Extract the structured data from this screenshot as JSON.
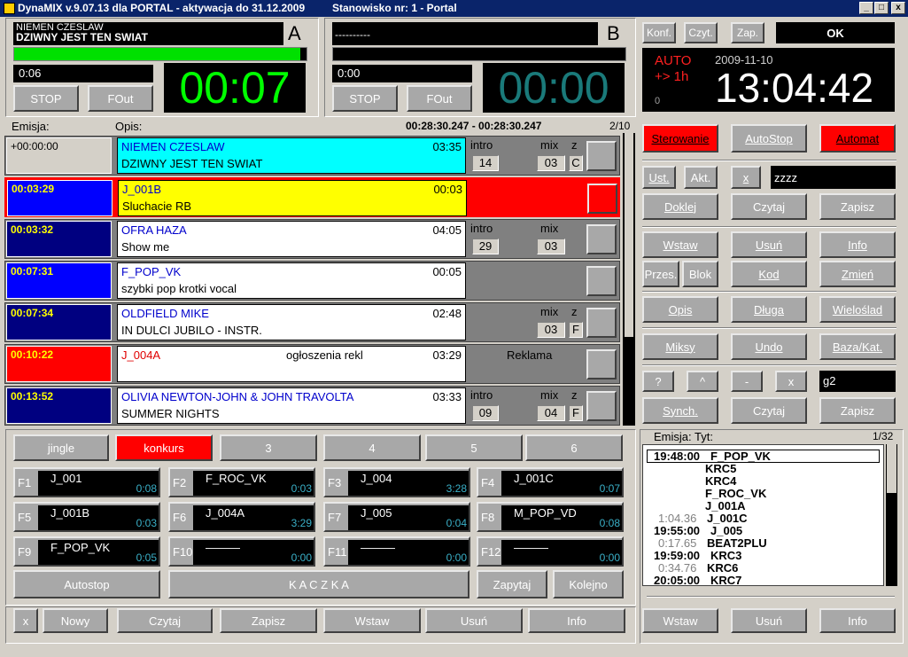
{
  "window": {
    "title": "DynaMIX v.9.07.13 dla PORTAL - aktywacja do 31.12.2009",
    "station": "Stanowisko nr: 1 - Portal",
    "min": "_",
    "max": "□",
    "close": "x"
  },
  "playerA": {
    "artist": "NIEMEN CZESLAW",
    "title": "DZIWNY JEST TEN SWIAT",
    "letter": "A",
    "elapsed": "0:06",
    "remaining": "00:07",
    "progress": 0.98,
    "stop": "STOP",
    "fout": "FOut"
  },
  "playerB": {
    "artist": "----------",
    "letter": "B",
    "elapsed": "0:00",
    "remaining": "00:00",
    "stop": "STOP",
    "fout": "FOut"
  },
  "top_right": {
    "konf": "Konf.",
    "czyt": "Czyt.",
    "zap": "Zap.",
    "ok": "OK",
    "auto": "AUTO",
    "offset": "+> 1h",
    "zero": "0",
    "date": "2009-11-10",
    "clock": "13:04:42"
  },
  "playlist": {
    "col_emisja": "Emisja:",
    "col_opis": "Opis:",
    "range": "00:28:30.247 - 00:28:30.247",
    "page": "2/10",
    "rows": [
      {
        "time": "+00:00:00",
        "artist": "NIEMEN CZESLAW",
        "title": "DZIWNY JEST TEN SWIAT",
        "dur": "03:35",
        "intro_lbl": "intro",
        "intro": "14",
        "mix_lbl": "mix",
        "mix": "03",
        "z_lbl": "z",
        "z": "C"
      },
      {
        "time": "00:03:29",
        "artist": "J_001B",
        "title": "Sluchacie RB",
        "dur": "00:03"
      },
      {
        "time": "00:03:32",
        "artist": "OFRA HAZA",
        "title": "Show me",
        "dur": "04:05",
        "intro_lbl": "intro",
        "intro": "29",
        "mix_lbl": "mix",
        "mix": "03"
      },
      {
        "time": "00:07:31",
        "artist": "F_POP_VK",
        "title": "szybki pop krotki vocal",
        "dur": "00:05"
      },
      {
        "time": "00:07:34",
        "artist": "OLDFIELD MIKE",
        "title": "IN DULCI JUBILO - INSTR.",
        "dur": "02:48",
        "mix_lbl": "mix",
        "mix": "03",
        "z_lbl": "z",
        "z": "F"
      },
      {
        "time": "00:10:22",
        "artist": "J_004A",
        "category": "ogłoszenia rekl",
        "dur": "03:29",
        "tag": "Reklama"
      },
      {
        "time": "00:13:52",
        "artist": "OLIVIA NEWTON-JOHN & JOHN TRAVOLTA",
        "title": "SUMMER NIGHTS",
        "dur": "03:33",
        "intro_lbl": "intro",
        "intro": "09",
        "mix_lbl": "mix",
        "mix": "04",
        "z_lbl": "z",
        "z": "F"
      }
    ]
  },
  "right_controls": {
    "sterowanie": "Sterowanie",
    "autostop": "AutoStop",
    "automat": "Automat",
    "ust": "Ust.",
    "akt": "Akt.",
    "x1": "x",
    "field1": "zzzz",
    "doklej": "Doklej",
    "czytaj1": "Czytaj",
    "zapisz1": "Zapisz",
    "wstaw": "Wstaw",
    "usun": "Usuń",
    "info": "Info",
    "przes": "Przes.",
    "blok": "Blok",
    "kod": "Kod",
    "zmien": "Zmień",
    "opis": "Opis",
    "dluga": "Długa",
    "wieloslad": "Wieloślad",
    "miksy": "Miksy",
    "undo": "Undo",
    "baza": "Baza/Kat.",
    "q": "?",
    "up": "^",
    "minus": "-",
    "x2": "x",
    "field2": "g2",
    "synch": "Synch.",
    "czytaj2": "Czytaj",
    "zapisz2": "Zapisz"
  },
  "jingle_tabs": [
    "jingle",
    "konkurs",
    "3",
    "4",
    "5",
    "6"
  ],
  "fkeys": [
    {
      "k": "F1",
      "n": "J_001",
      "v": "0:08"
    },
    {
      "k": "F2",
      "n": "F_ROC_VK",
      "v": "0:03"
    },
    {
      "k": "F3",
      "n": "J_004",
      "v": "3:28"
    },
    {
      "k": "F4",
      "n": "J_001C",
      "v": "0:07"
    },
    {
      "k": "F5",
      "n": "J_001B",
      "v": "0:03"
    },
    {
      "k": "F6",
      "n": "J_004A",
      "v": "3:29"
    },
    {
      "k": "F7",
      "n": "J_005",
      "v": "0:04"
    },
    {
      "k": "F8",
      "n": "M_POP_VD",
      "v": "0:08"
    },
    {
      "k": "F9",
      "n": "F_POP_VK",
      "v": "0:05"
    },
    {
      "k": "F10",
      "n": "———",
      "v": "0:00"
    },
    {
      "k": "F11",
      "n": "———",
      "v": "0:00"
    },
    {
      "k": "F12",
      "n": "———",
      "v": "0:00"
    }
  ],
  "jingle_bottom": {
    "autostop": "Autostop",
    "name": "K A C Z K A",
    "zapytaj": "Zapytaj",
    "kolejno": "Kolejno"
  },
  "bottom_bar": {
    "x": "x",
    "nowy": "Nowy",
    "czytaj": "Czytaj",
    "zapisz": "Zapisz",
    "wstaw": "Wstaw",
    "usun": "Usuń",
    "info": "Info"
  },
  "schedule": {
    "header": "Emisja: Tyt:",
    "page": "1/32",
    "wstaw": "Wstaw",
    "usun": "Usuń",
    "info": "Info",
    "items": [
      {
        "t": "19:48:00",
        "n": "F_POP_VK"
      },
      {
        "t": "",
        "n": "KRC5"
      },
      {
        "t": "",
        "n": "KRC4"
      },
      {
        "t": "",
        "n": "F_ROC_VK"
      },
      {
        "t": "",
        "n": "J_001A"
      },
      {
        "t": "1:04.36",
        "n": "J_001C"
      },
      {
        "t": "19:55:00",
        "n": "J_005"
      },
      {
        "t": "0:17.65",
        "n": "BEAT2PLU"
      },
      {
        "t": "19:59:00",
        "n": "KRC3"
      },
      {
        "t": "0:34.76",
        "n": "KRC6"
      },
      {
        "t": "20:05:00",
        "n": "KRC7"
      }
    ]
  },
  "colors": {
    "cyan": "#00ffff",
    "yellow": "#ffff00",
    "blue": "#0000ff",
    "navy": "#000080",
    "red": "#ff0000",
    "green": "#00ff00"
  }
}
